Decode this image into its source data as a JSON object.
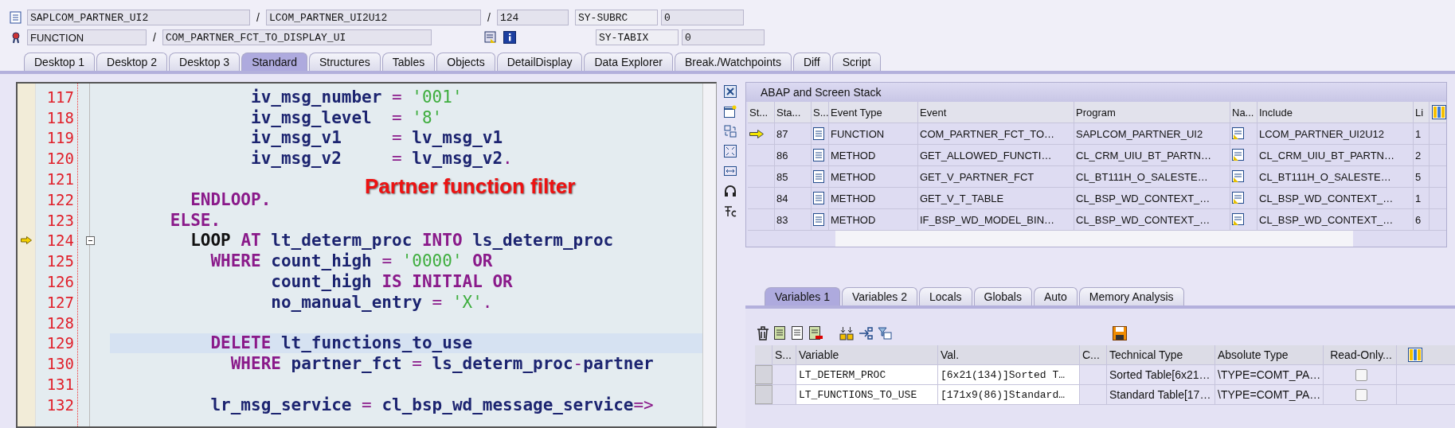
{
  "header": {
    "row1": {
      "program": "SAPLCOM_PARTNER_UI2",
      "separators": [
        "/",
        "/"
      ],
      "include": "LCOM_PARTNER_UI2U12",
      "line": "124",
      "field_name": "SY-SUBRC",
      "field_value": "0"
    },
    "row2": {
      "event_type": "FUNCTION",
      "separator": "/",
      "event": "COM_PARTNER_FCT_TO_DISPLAY_UI",
      "field_name": "SY-TABIX",
      "field_value": "0"
    }
  },
  "tabs": [
    {
      "label": "Desktop 1",
      "selected": false
    },
    {
      "label": "Desktop 2",
      "selected": false
    },
    {
      "label": "Desktop 3",
      "selected": false
    },
    {
      "label": "Standard",
      "selected": true
    },
    {
      "label": "Structures",
      "selected": false
    },
    {
      "label": "Tables",
      "selected": false
    },
    {
      "label": "Objects",
      "selected": false
    },
    {
      "label": "DetailDisplay",
      "selected": false
    },
    {
      "label": "Data Explorer",
      "selected": false
    },
    {
      "label": "Break./Watchpoints",
      "selected": false
    },
    {
      "label": "Diff",
      "selected": false
    },
    {
      "label": "Script",
      "selected": false
    }
  ],
  "code": {
    "annotation": "Partner function filter",
    "lines": [
      {
        "number": "117",
        "current": false,
        "highlighted": false,
        "collapsible": false,
        "tokens": [
          {
            "text": "              iv_msg_number ",
            "kind": "id"
          },
          {
            "text": "= ",
            "kind": "op"
          },
          {
            "text": "'001'",
            "kind": "str"
          }
        ]
      },
      {
        "number": "118",
        "current": false,
        "highlighted": false,
        "collapsible": false,
        "tokens": [
          {
            "text": "              iv_msg_level  ",
            "kind": "id"
          },
          {
            "text": "= ",
            "kind": "op"
          },
          {
            "text": "'8'",
            "kind": "str"
          }
        ]
      },
      {
        "number": "119",
        "current": false,
        "highlighted": false,
        "collapsible": false,
        "tokens": [
          {
            "text": "              iv_msg_v1     ",
            "kind": "id"
          },
          {
            "text": "= ",
            "kind": "op"
          },
          {
            "text": "lv_msg_v1",
            "kind": "id"
          }
        ]
      },
      {
        "number": "120",
        "current": false,
        "highlighted": false,
        "collapsible": false,
        "tokens": [
          {
            "text": "              iv_msg_v2     ",
            "kind": "id"
          },
          {
            "text": "= ",
            "kind": "op"
          },
          {
            "text": "lv_msg_v2",
            "kind": "id"
          },
          {
            "text": ".",
            "kind": "op"
          }
        ]
      },
      {
        "number": "121",
        "current": false,
        "highlighted": false,
        "collapsible": false
      },
      {
        "number": "122",
        "current": false,
        "highlighted": false,
        "collapsible": false,
        "tokens": [
          {
            "text": "        ENDLOOP.",
            "kind": "kw"
          }
        ]
      },
      {
        "number": "123",
        "current": false,
        "highlighted": false,
        "collapsible": false,
        "tokens": [
          {
            "text": "      ELSE.",
            "kind": "kw"
          }
        ]
      },
      {
        "number": "124",
        "current": true,
        "highlighted": false,
        "collapsible": true,
        "tokens": [
          {
            "text": "        LOOP ",
            "kind": "kw2"
          },
          {
            "text": "AT ",
            "kind": "kw"
          },
          {
            "text": "lt_determ_proc ",
            "kind": "id"
          },
          {
            "text": "INTO ",
            "kind": "kw"
          },
          {
            "text": "ls_determ_proc",
            "kind": "id"
          }
        ]
      },
      {
        "number": "125",
        "current": false,
        "highlighted": false,
        "collapsible": false,
        "tokens": [
          {
            "text": "          WHERE ",
            "kind": "kw"
          },
          {
            "text": "count_high ",
            "kind": "id"
          },
          {
            "text": "= ",
            "kind": "op"
          },
          {
            "text": "'0000' ",
            "kind": "str"
          },
          {
            "text": "OR",
            "kind": "kw"
          }
        ]
      },
      {
        "number": "126",
        "current": false,
        "highlighted": false,
        "collapsible": false,
        "tokens": [
          {
            "text": "                count_high ",
            "kind": "id"
          },
          {
            "text": "IS INITIAL OR",
            "kind": "kw"
          }
        ]
      },
      {
        "number": "127",
        "current": false,
        "highlighted": false,
        "collapsible": false,
        "tokens": [
          {
            "text": "                no_manual_entry ",
            "kind": "id"
          },
          {
            "text": "= ",
            "kind": "op"
          },
          {
            "text": "'X'",
            "kind": "str"
          },
          {
            "text": ".",
            "kind": "op"
          }
        ]
      },
      {
        "number": "128",
        "current": false,
        "highlighted": false,
        "collapsible": false
      },
      {
        "number": "129",
        "current": false,
        "highlighted": true,
        "collapsible": false,
        "tokens": [
          {
            "text": "          DELETE ",
            "kind": "kw"
          },
          {
            "text": "lt_functions_to_use",
            "kind": "id"
          }
        ]
      },
      {
        "number": "130",
        "current": false,
        "highlighted": false,
        "collapsible": false,
        "tokens": [
          {
            "text": "            WHERE ",
            "kind": "kw"
          },
          {
            "text": "partner_fct ",
            "kind": "id"
          },
          {
            "text": "= ",
            "kind": "op"
          },
          {
            "text": "ls_determ_proc",
            "kind": "id"
          },
          {
            "text": "-",
            "kind": "op"
          },
          {
            "text": "partner",
            "kind": "id"
          }
        ]
      },
      {
        "number": "131",
        "current": false,
        "highlighted": false,
        "collapsible": false
      },
      {
        "number": "132",
        "current": false,
        "highlighted": false,
        "collapsible": false,
        "tokens": [
          {
            "text": "          lr_msg_service ",
            "kind": "id"
          },
          {
            "text": "= ",
            "kind": "op"
          },
          {
            "text": "cl_bsp_wd_message_service",
            "kind": "id"
          },
          {
            "text": "=>",
            "kind": "op"
          }
        ]
      }
    ]
  },
  "stack": {
    "title": "ABAP and Screen Stack",
    "columns": [
      "St...",
      "Sta...",
      "S...",
      "Event Type",
      "Event",
      "Program",
      "Na...",
      "Include",
      "Li"
    ],
    "rows": [
      {
        "current": true,
        "level": "87",
        "event_type": "FUNCTION",
        "event": "COM_PARTNER_FCT_TO…",
        "program": "SAPLCOM_PARTNER_UI2",
        "include": "LCOM_PARTNER_UI2U12",
        "column_9": "1"
      },
      {
        "current": false,
        "level": "86",
        "event_type": "METHOD",
        "event": "GET_ALLOWED_FUNCTI…",
        "program": "CL_CRM_UIU_BT_PARTN…",
        "include": "CL_CRM_UIU_BT_PARTN…",
        "column_9": "2"
      },
      {
        "current": false,
        "level": "85",
        "event_type": "METHOD",
        "event": "GET_V_PARTNER_FCT",
        "program": "CL_BT111H_O_SALESTE…",
        "include": "CL_BT111H_O_SALESTE…",
        "column_9": "5"
      },
      {
        "current": false,
        "level": "84",
        "event_type": "METHOD",
        "event": "GET_V_T_TABLE",
        "program": "CL_BSP_WD_CONTEXT_…",
        "include": "CL_BSP_WD_CONTEXT_…",
        "column_9": "1"
      },
      {
        "current": false,
        "level": "83",
        "event_type": "METHOD",
        "event": "IF_BSP_WD_MODEL_BIN…",
        "program": "CL_BSP_WD_CONTEXT_…",
        "include": "CL_BSP_WD_CONTEXT_…",
        "column_9": "6"
      }
    ]
  },
  "variable_tabs": [
    {
      "label": "Variables 1",
      "selected": true
    },
    {
      "label": "Variables 2",
      "selected": false
    },
    {
      "label": "Locals",
      "selected": false
    },
    {
      "label": "Globals",
      "selected": false
    },
    {
      "label": "Auto",
      "selected": false
    },
    {
      "label": "Memory Analysis",
      "selected": false
    }
  ],
  "variables": {
    "columns": [
      "S...",
      "Variable",
      "Val.",
      "C...",
      "Technical Type",
      "Absolute Type",
      "Read-Only..."
    ],
    "rows": [
      {
        "variable": "LT_DETERM_PROC",
        "value": "[6x21(134)]Sorted T…",
        "technical_type": "Sorted Table[6x21…",
        "absolute_type": "\\TYPE=COMT_PA…",
        "read_only": false
      },
      {
        "variable": "LT_FUNCTIONS_TO_USE",
        "value": "[171x9(86)]Standard…",
        "technical_type": "Standard Table[17…",
        "absolute_type": "\\TYPE=COMT_PA…",
        "read_only": false
      }
    ]
  }
}
